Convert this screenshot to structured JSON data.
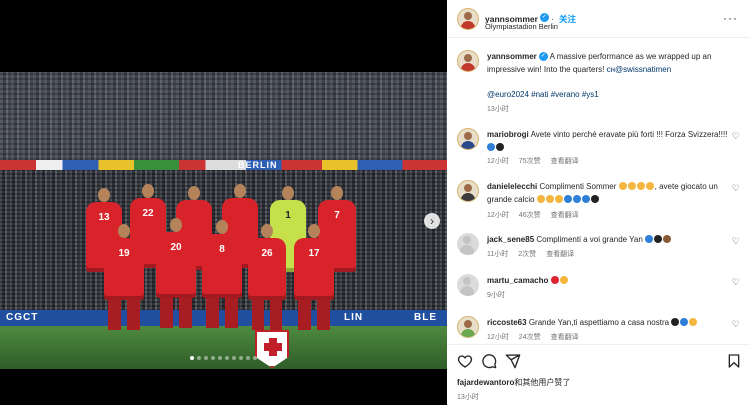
{
  "header": {
    "username": "yannsommer",
    "follow_label": "关注",
    "location": "Olympiastadion Berlin",
    "more_icon": "more-horizontal-icon"
  },
  "caption": {
    "username": "yannsommer",
    "text": "A massive performance as we wrapped up an impressive win! Into the quarters!",
    "mention": "cн@swissnatimen",
    "hashtags": "@euro2024 #nati #verano #ys1",
    "time": "13小时"
  },
  "photo": {
    "ribbon_text": "BERLIN",
    "board_text_left": "CGCT",
    "board_text_mid": "LIN",
    "board_text_right": "BLE",
    "player_numbers": [
      "13",
      "22",
      "20",
      "8",
      "26",
      "17",
      "19",
      "5",
      "7",
      "1"
    ],
    "carousel_index": 0,
    "carousel_count": 10
  },
  "comments": [
    {
      "username": "mariobrogi",
      "text": "Avete vinto perché eravate più forti !!! Forza Svizzera!!!!",
      "emojis": [
        "blue",
        "black"
      ],
      "time": "12小时",
      "likes": "75次赞",
      "translate": "查看翻译"
    },
    {
      "username": "danielelecchi",
      "text": "Complimenti Sommer",
      "emojis_mid": [
        "yellow",
        "yellow",
        "yellow",
        "yellow"
      ],
      "text2": ", avete giocato un grande calcio",
      "emojis": [
        "yellow",
        "yellow",
        "yellow",
        "blue",
        "blue",
        "blue",
        "black"
      ],
      "time": "12小时",
      "likes": "46次赞",
      "translate": "查看翻译"
    },
    {
      "username": "jack_sene85",
      "text": "Complimenti a voi grande Yan",
      "emojis": [
        "blue",
        "black",
        "brown"
      ],
      "time": "11小时",
      "likes": "2次赞",
      "translate": "查看翻译"
    },
    {
      "username": "martu_camacho",
      "text": "",
      "emojis": [
        "red",
        "yellow"
      ],
      "time": "9小时"
    },
    {
      "username": "riccoste63",
      "text": "Grande Yan,ti aspettiamo a casa nostra",
      "emojis": [
        "black",
        "blue",
        "yellow"
      ],
      "time": "12小时",
      "likes": "24次赞",
      "translate": "查看翻译"
    }
  ],
  "footer": {
    "liked_by_user": "fajardewantoro",
    "liked_by_suffix": "和其他用户赞了",
    "time": "13小时"
  },
  "icons": [
    "heart-icon",
    "comment-icon",
    "share-icon",
    "bookmark-icon",
    "chevron-right-icon"
  ]
}
